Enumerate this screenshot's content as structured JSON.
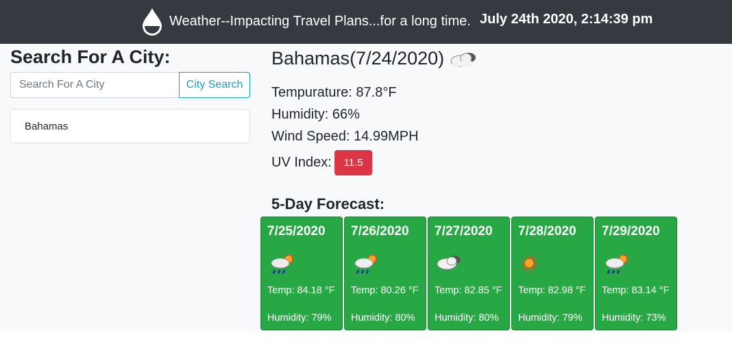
{
  "header": {
    "title": "Weather--Impacting Travel Plans...for a long time.",
    "datetime": "July 24th 2020, 2:14:39 pm",
    "icon": "water-drop-icon"
  },
  "search": {
    "heading": "Search For A City:",
    "placeholder": "Search For A City",
    "button_label": "City Search",
    "history": [
      "Bahamas"
    ]
  },
  "current": {
    "title": "Bahamas(7/24/2020)",
    "icon": "partly-cloudy-icon",
    "temperature": "Tempurature: 87.8°F",
    "humidity": "Humidity: 66%",
    "wind": "Wind Speed: 14.99MPH",
    "uv_label": "UV Index:",
    "uv_value": "11.5",
    "uv_color": "#dc3545"
  },
  "forecast": {
    "heading": "5-Day Forecast:",
    "card_color": "#28a745",
    "days": [
      {
        "date": "7/25/2020",
        "icon": "rain-sun-icon",
        "temp": "Temp: 84.18 °F",
        "humidity": "Humidity: 79%"
      },
      {
        "date": "7/26/2020",
        "icon": "rain-sun-icon",
        "temp": "Temp: 80.26 °F",
        "humidity": "Humidity: 80%"
      },
      {
        "date": "7/27/2020",
        "icon": "cloud-icon",
        "temp": "Temp: 82.85 °F",
        "humidity": "Humidity: 80%"
      },
      {
        "date": "7/28/2020",
        "icon": "sun-icon",
        "temp": "Temp: 82.98 °F",
        "humidity": "Humidity: 79%"
      },
      {
        "date": "7/29/2020",
        "icon": "rain-sun-icon",
        "temp": "Temp: 83.14 °F",
        "humidity": "Humidity: 73%"
      }
    ]
  }
}
